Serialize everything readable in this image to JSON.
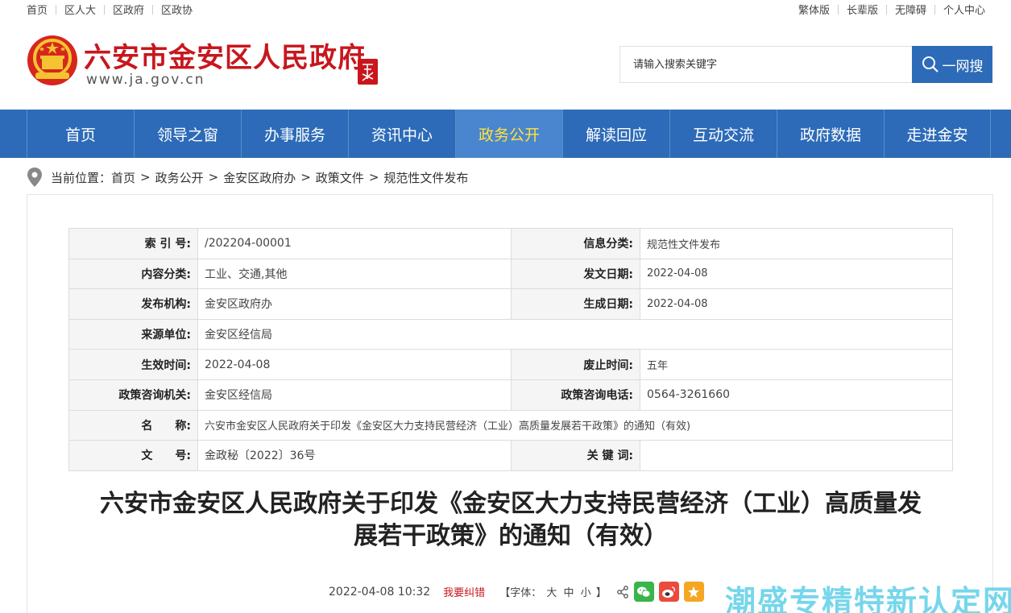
{
  "topbar": {
    "left_links": [
      "首页",
      "区人大",
      "区政府",
      "区政协"
    ],
    "right_links": [
      "繁体版",
      "长辈版",
      "无障碍",
      "个人中心"
    ]
  },
  "header": {
    "title": "六安市金安区人民政府",
    "url": "www.ja.gov.cn",
    "search_placeholder": "请输入搜索关键字",
    "search_button": "一网搜"
  },
  "nav": {
    "items": [
      "首页",
      "领导之窗",
      "办事服务",
      "资讯中心",
      "政务公开",
      "解读回应",
      "互动交流",
      "政府数据",
      "走进金安"
    ],
    "active": "政务公开"
  },
  "breadcrumb": {
    "prefix": "当前位置：",
    "items": [
      "首页",
      "政务公开",
      "金安区政府办",
      "政策文件",
      "规范性文件发布"
    ]
  },
  "meta": {
    "index_no_label": "索 引 号:",
    "index_no": "/202204-00001",
    "info_category_label": "信息分类:",
    "info_category": "规范性文件发布",
    "content_category_label": "内容分类:",
    "content_category": "工业、交通,其他",
    "issue_date_label": "发文日期:",
    "issue_date": "2022-04-08",
    "publisher_label": "发布机构:",
    "publisher": "金安区政府办",
    "created_date_label": "生成日期:",
    "created_date": "2022-04-08",
    "source_label": "来源单位:",
    "source": "金安区经信局",
    "effective_label": "生效时间:",
    "effective": "2022-04-08",
    "expiry_label": "废止时间:",
    "expiry": "五年",
    "consult_org_label": "政策咨询机关:",
    "consult_org": "金安区经信局",
    "consult_phone_label": "政策咨询电话:",
    "consult_phone": "0564-3261660",
    "name_label": "名　　称:",
    "name": "六安市金安区人民政府关于印发《金安区大力支持民营经济（工业）高质量发展若干政策》的通知（有效)",
    "doc_no_label": "文　　号:",
    "doc_no": "金政秘〔2022〕36号",
    "keywords_label": "关 键 词:",
    "keywords": ""
  },
  "document": {
    "title_line1": "六安市金安区人民政府关于印发《金安区大力支持民营经济（工业）高质量发",
    "title_line2": "展若干政策》的通知（有效）",
    "datetime": "2022-04-08 10:32",
    "report_error": "我要纠错",
    "font_label_open": "【字体：",
    "font_large": "大",
    "font_medium": "中",
    "font_small": "小",
    "font_label_close": "】"
  },
  "watermark": "潮盛专精特新认定网",
  "colors": {
    "brand_red": "#c8161d",
    "nav_blue": "#2d6bb8",
    "nav_active_text": "#ffe23c"
  }
}
